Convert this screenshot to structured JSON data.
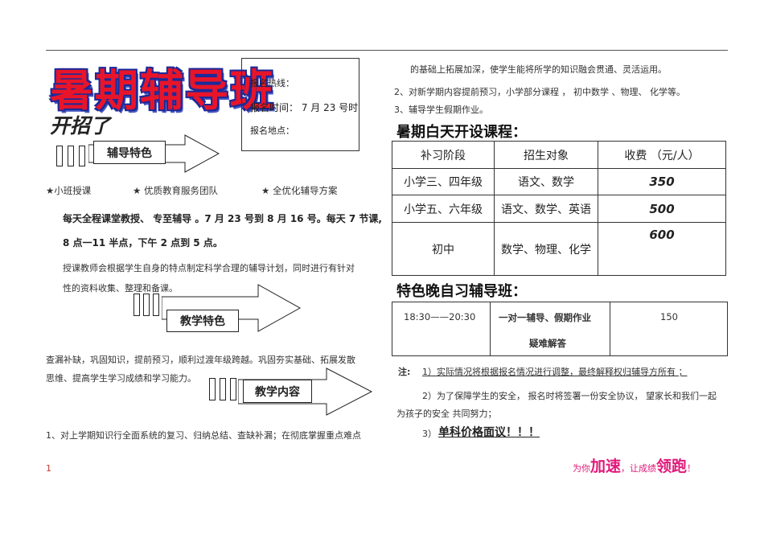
{
  "header": {
    "title": "暑期辅导班",
    "subtitle": "开招了"
  },
  "info_box": {
    "hotline": "报名热线：",
    "time": "报名时间：  7 月 23 号时",
    "place": "报名地点："
  },
  "section1": {
    "arrow_label": "辅导特色",
    "features": [
      "★小班授课",
      "★  优质教育服务团队",
      "★  全优化辅导方案"
    ],
    "schedule_line1": "每天全程课堂教授、  专至辅导 。7 月 23 号到 8 月 16 号。每天 7 节课,",
    "schedule_line2": "8 点一11 半点，下午  2 点到 5 点。",
    "plan_line1": "授课教师会根据学生自身的特点制定科学合理的辅导计划，同时进行有针对",
    "plan_line2": "性的资料收集、整理和备课。"
  },
  "section2": {
    "arrow_label": "教学特色",
    "text_line1": "查漏补缺，巩固知识，提前预习，顺利过渡年级跨越。巩固夯实基础、拓展发散",
    "text_line2": "思维、提高学生学习成绩和学习能力。"
  },
  "section3": {
    "arrow_label": "教学内容",
    "item1": "1、对上学期知识行全面系统的复习、归纳总结、查缺补漏；在彻底掌握重点难点"
  },
  "right_col": {
    "continuation": "的基础上拓展加深，使学生能将所学的知识融会贯通、灵活运用。",
    "item2": "2、对新学期内容提前预习，小学部分课程      ，   初中数学  、物理、  化学等。",
    "item3": "3、辅导学生假期作业。"
  },
  "day_course": {
    "heading": "暑期白天开设课程：",
    "columns": [
      "补习阶段",
      "招生对象",
      "收费  （元/人）"
    ],
    "rows": [
      {
        "stage": "小学三、四年级",
        "subjects": "语文、数学",
        "fee": "350"
      },
      {
        "stage": "小学五、六年级",
        "subjects": "语文、数学、英语",
        "fee": "500"
      },
      {
        "stage": "初中",
        "subjects": "数学、物理、化学",
        "fee": "600"
      }
    ]
  },
  "evening": {
    "heading": "特色晚自习辅导班：",
    "time": "18:30——20:30",
    "desc_line1": "一对一辅导、假期作业",
    "desc_line2": "疑难解答",
    "fee": "150"
  },
  "notes": {
    "label": "注:",
    "note1": "1）实际情况将根据报名情况进行调整，最终解释权归辅导方所有          ；",
    "note2_line1": "2）为了保障学生的安全，   报名时将签署一份安全协议，   望家长和我们一起",
    "note2_line2": "为孩子的安全    共同努力；",
    "note3_num": "3）",
    "note3_text": "单科价格面议！！！"
  },
  "footer": {
    "page_number": "1",
    "slogan_a": "为你",
    "slogan_b": "加速",
    "slogan_c": "，让成绩",
    "slogan_d": "领跑",
    "slogan_e": "！"
  },
  "colors": {
    "title_red": "#e8152a",
    "title_outline": "#1a2a9a",
    "slogan_pink": "#e0197a"
  }
}
